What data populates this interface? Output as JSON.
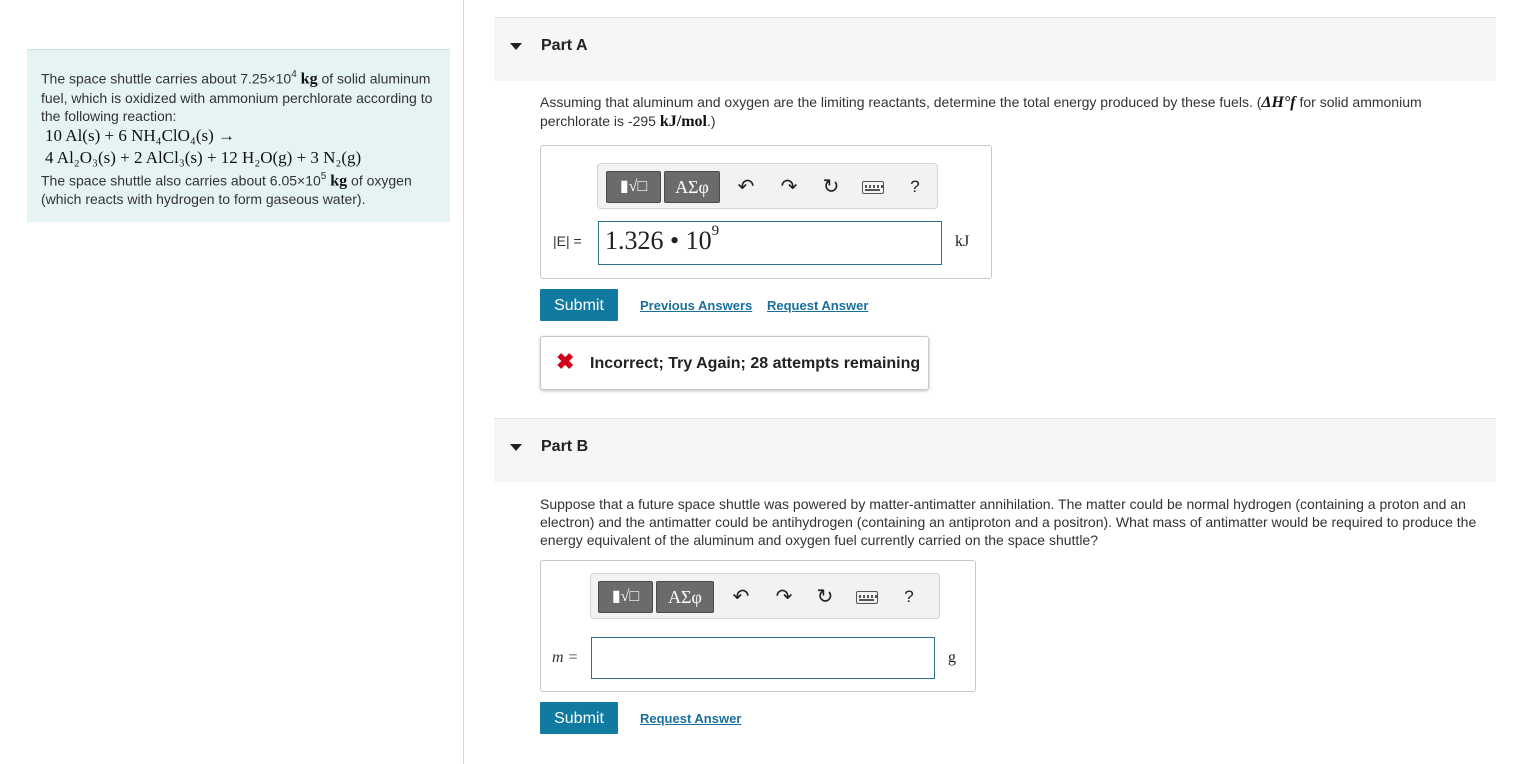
{
  "left_panel": {
    "intro_a": "The space shuttle carries about 7.25×10",
    "intro_exp": "4",
    "intro_unit": "kg",
    "intro_b": " of solid aluminum fuel, which is oxidized with ammonium perchlorate according to the following reaction:",
    "eq_line1": "10 Al(s) + 6 NH₄ClO₄(s) →",
    "eq_line2": "4 Al₂O₃(s) + 2 AlCl₃(s) + 12 H₂O(g) + 3 N₂(g)",
    "o2_a": "The space shuttle also carries about 6.05×10",
    "o2_exp": "5",
    "o2_unit": "kg",
    "o2_b": " of oxygen (which reacts with hydrogen to form gaseous water)."
  },
  "toolbar": {
    "template_label": "▮√□",
    "symbols_label": "ΑΣφ",
    "undo_glyph": "↶",
    "redo_glyph": "↷",
    "reset_glyph": "↻",
    "help_label": "?"
  },
  "part_a": {
    "title": "Part A",
    "question_a": "Assuming that aluminum and oxygen are the limiting reactants, determine the total energy produced by these fuels. (",
    "question_math": "ΔH°f",
    "question_b": " for solid ammonium perchlorate is -295 ",
    "question_units": "kJ/mol",
    "question_c": ".)",
    "answer_label": "|E| =",
    "answer_value": "1.326 • 10",
    "answer_exp": "9",
    "unit": "kJ",
    "submit_label": "Submit",
    "previous_answers": "Previous Answers",
    "request_answer": "Request Answer",
    "feedback_icon": "✖",
    "feedback": "Incorrect; Try Again; 28 attempts remaining"
  },
  "part_b": {
    "title": "Part B",
    "question": "Suppose that a future space shuttle was powered by matter-antimatter annihilation. The matter could be normal hydrogen (containing a proton and an electron) and the antimatter could be antihydrogen (containing an antiproton and a positron). What mass of antimatter would be required to produce the energy equivalent of the aluminum and oxygen fuel currently carried on the space shuttle?",
    "answer_label": "m =",
    "answer_value": "",
    "unit": "g",
    "submit_label": "Submit",
    "request_answer": "Request Answer"
  },
  "colors": {
    "submit": "#117aa0",
    "link": "#1a6f9c",
    "error": "#d0021b",
    "panel_bg": "#e6f3f5"
  }
}
